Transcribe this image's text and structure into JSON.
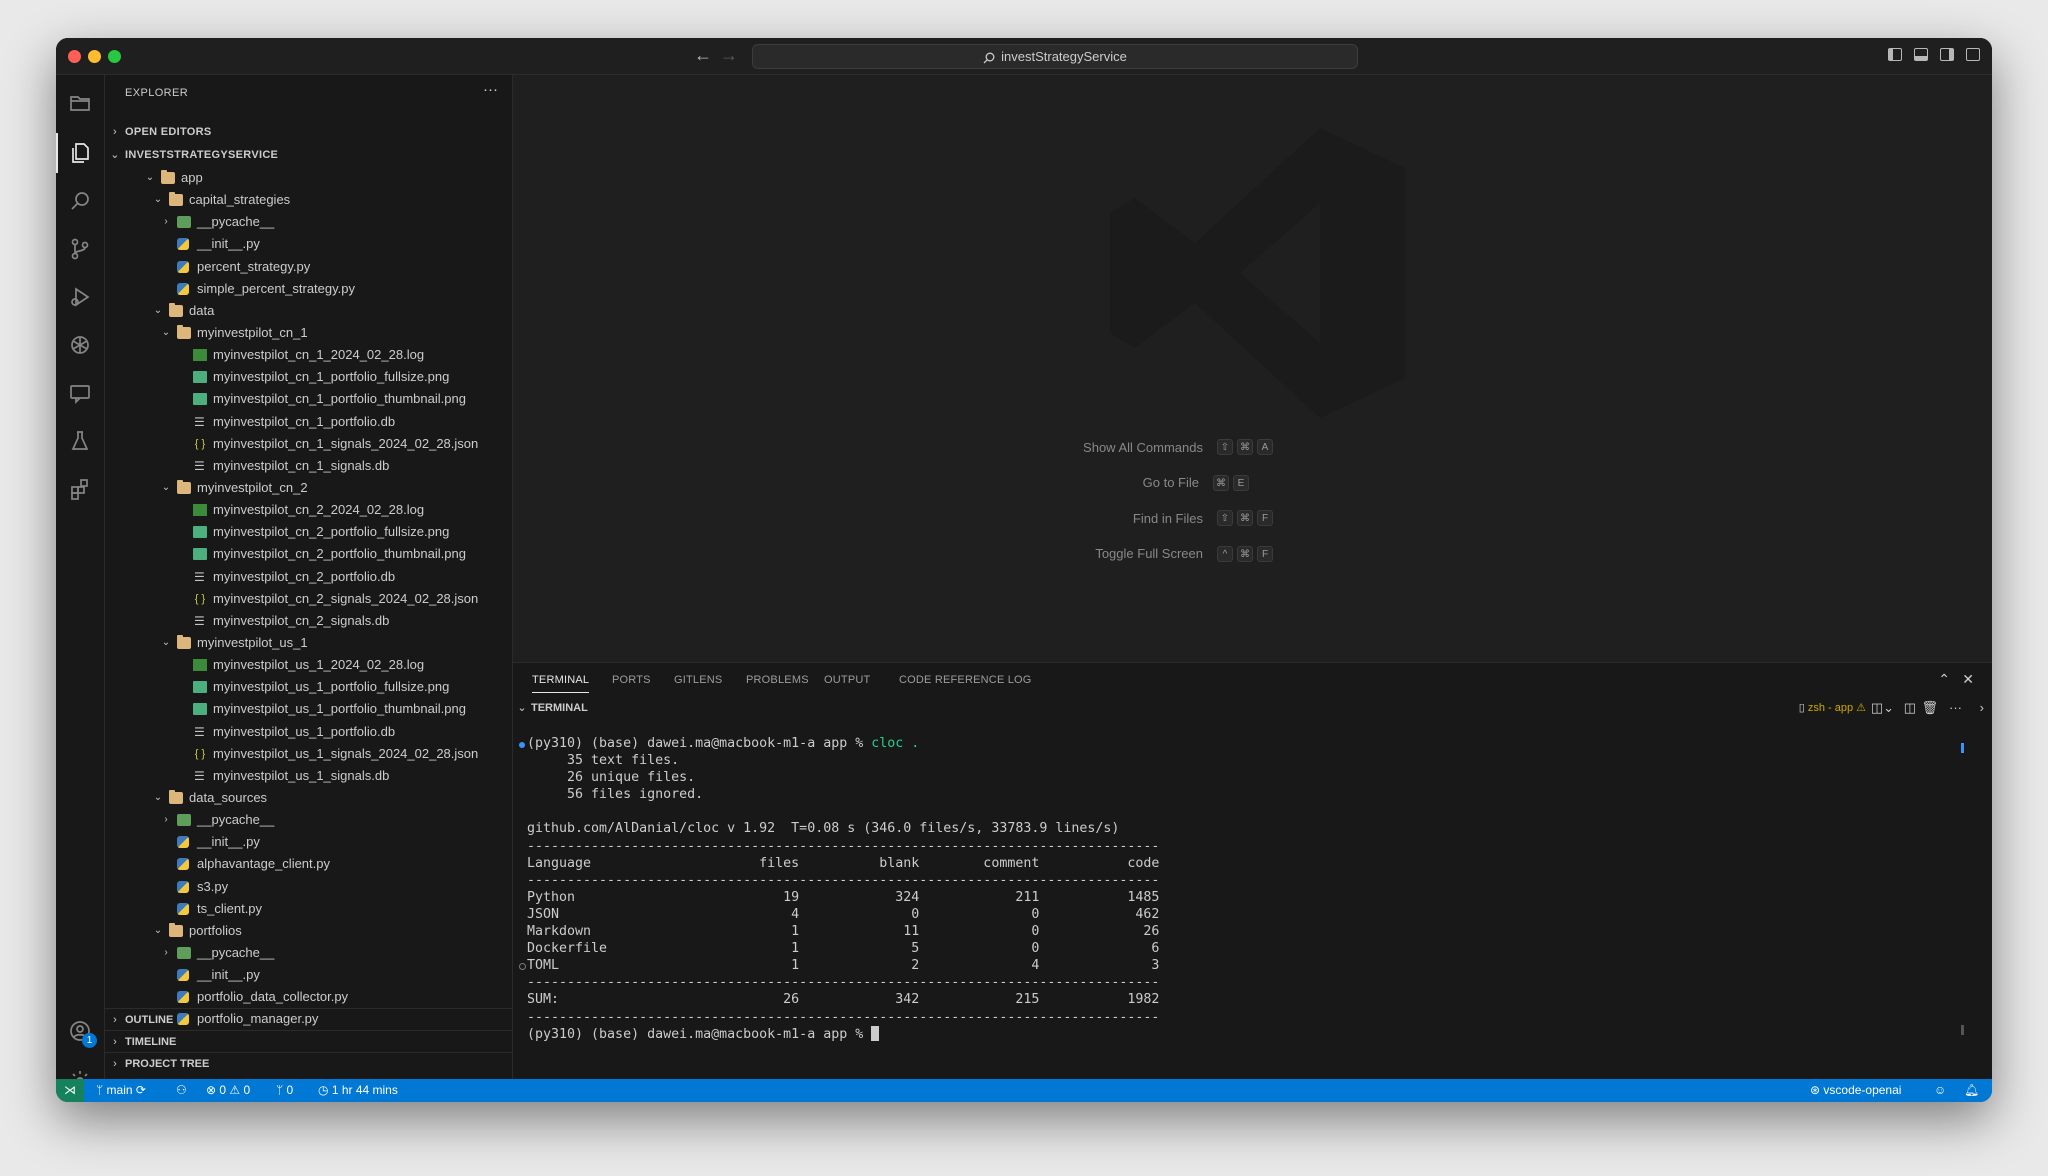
{
  "window": {
    "search": "investStrategyService"
  },
  "sidebar": {
    "title": "EXPLORER",
    "open_editors": "OPEN EDITORS",
    "project": "INVESTSTRATEGYSERVICE",
    "tree": [
      {
        "name": "app",
        "depth": 0,
        "type": "folder-open",
        "twisty": "open"
      },
      {
        "name": "capital_strategies",
        "depth": 1,
        "type": "folder-open",
        "twisty": "open"
      },
      {
        "name": "__pycache__",
        "depth": 2,
        "type": "folder-g",
        "twisty": "closed"
      },
      {
        "name": "__init__.py",
        "depth": 2,
        "type": "py"
      },
      {
        "name": "percent_strategy.py",
        "depth": 2,
        "type": "py"
      },
      {
        "name": "simple_percent_strategy.py",
        "depth": 2,
        "type": "py"
      },
      {
        "name": "data",
        "depth": 1,
        "type": "folder-open",
        "twisty": "open"
      },
      {
        "name": "myinvestpilot_cn_1",
        "depth": 2,
        "type": "folder-open",
        "twisty": "open"
      },
      {
        "name": "myinvestpilot_cn_1_2024_02_28.log",
        "depth": 3,
        "type": "log"
      },
      {
        "name": "myinvestpilot_cn_1_portfolio_fullsize.png",
        "depth": 3,
        "type": "png"
      },
      {
        "name": "myinvestpilot_cn_1_portfolio_thumbnail.png",
        "depth": 3,
        "type": "png"
      },
      {
        "name": "myinvestpilot_cn_1_portfolio.db",
        "depth": 3,
        "type": "db"
      },
      {
        "name": "myinvestpilot_cn_1_signals_2024_02_28.json",
        "depth": 3,
        "type": "json"
      },
      {
        "name": "myinvestpilot_cn_1_signals.db",
        "depth": 3,
        "type": "db"
      },
      {
        "name": "myinvestpilot_cn_2",
        "depth": 2,
        "type": "folder-open",
        "twisty": "open"
      },
      {
        "name": "myinvestpilot_cn_2_2024_02_28.log",
        "depth": 3,
        "type": "log"
      },
      {
        "name": "myinvestpilot_cn_2_portfolio_fullsize.png",
        "depth": 3,
        "type": "png"
      },
      {
        "name": "myinvestpilot_cn_2_portfolio_thumbnail.png",
        "depth": 3,
        "type": "png"
      },
      {
        "name": "myinvestpilot_cn_2_portfolio.db",
        "depth": 3,
        "type": "db"
      },
      {
        "name": "myinvestpilot_cn_2_signals_2024_02_28.json",
        "depth": 3,
        "type": "json"
      },
      {
        "name": "myinvestpilot_cn_2_signals.db",
        "depth": 3,
        "type": "db"
      },
      {
        "name": "myinvestpilot_us_1",
        "depth": 2,
        "type": "folder-open",
        "twisty": "open"
      },
      {
        "name": "myinvestpilot_us_1_2024_02_28.log",
        "depth": 3,
        "type": "log"
      },
      {
        "name": "myinvestpilot_us_1_portfolio_fullsize.png",
        "depth": 3,
        "type": "png"
      },
      {
        "name": "myinvestpilot_us_1_portfolio_thumbnail.png",
        "depth": 3,
        "type": "png"
      },
      {
        "name": "myinvestpilot_us_1_portfolio.db",
        "depth": 3,
        "type": "db"
      },
      {
        "name": "myinvestpilot_us_1_signals_2024_02_28.json",
        "depth": 3,
        "type": "json"
      },
      {
        "name": "myinvestpilot_us_1_signals.db",
        "depth": 3,
        "type": "db"
      },
      {
        "name": "data_sources",
        "depth": 1,
        "type": "folder-open",
        "twisty": "open"
      },
      {
        "name": "__pycache__",
        "depth": 2,
        "type": "folder-g",
        "twisty": "closed"
      },
      {
        "name": "__init__.py",
        "depth": 2,
        "type": "py"
      },
      {
        "name": "alphavantage_client.py",
        "depth": 2,
        "type": "py"
      },
      {
        "name": "s3.py",
        "depth": 2,
        "type": "py"
      },
      {
        "name": "ts_client.py",
        "depth": 2,
        "type": "py"
      },
      {
        "name": "portfolios",
        "depth": 1,
        "type": "folder-open",
        "twisty": "open"
      },
      {
        "name": "__pycache__",
        "depth": 2,
        "type": "folder-g",
        "twisty": "closed"
      },
      {
        "name": "__init__.py",
        "depth": 2,
        "type": "py"
      },
      {
        "name": "portfolio_data_collector.py",
        "depth": 2,
        "type": "py"
      },
      {
        "name": "portfolio_manager.py",
        "depth": 2,
        "type": "py"
      }
    ],
    "outline": "OUTLINE",
    "timeline": "TIMELINE",
    "project_tree": "PROJECT TREE"
  },
  "editor": {
    "shortcuts": [
      {
        "label": "Show All Commands",
        "keys": [
          "⇧",
          "⌘",
          "A"
        ]
      },
      {
        "label": "Go to File",
        "keys": [
          "⌘",
          "E"
        ]
      },
      {
        "label": "Find in Files",
        "keys": [
          "⇧",
          "⌘",
          "F"
        ]
      },
      {
        "label": "Toggle Full Screen",
        "keys": [
          "^",
          "⌘",
          "F"
        ]
      }
    ]
  },
  "panel": {
    "tabs": [
      "TERMINAL",
      "PORTS",
      "GITLENS",
      "PROBLEMS",
      "OUTPUT",
      "CODE REFERENCE LOG"
    ],
    "active_tab": "TERMINAL",
    "terminal_header": "TERMINAL",
    "shell_label": "zsh - app",
    "prompt": "(py310) (base) dawei.ma@macbook-m1-a app % ",
    "command": "cloc .",
    "output_lines": [
      "     35 text files.",
      "     26 unique files.",
      "     56 files ignored.",
      "",
      "github.com/AlDanial/cloc v 1.92  T=0.08 s (346.0 files/s, 33783.9 lines/s)",
      "-------------------------------------------------------------------------------",
      "Language                     files          blank        comment           code",
      "-------------------------------------------------------------------------------",
      "Python                          19            324            211           1485",
      "JSON                             4              0              0            462",
      "Markdown                         1             11              0             26",
      "Dockerfile                       1              5              0              6",
      "TOML                             1              2              4              3",
      "-------------------------------------------------------------------------------",
      "SUM:                            26            342            215           1982",
      "-------------------------------------------------------------------------------"
    ]
  },
  "statusbar": {
    "branch": "main",
    "errors": "0",
    "warnings": "0",
    "ports": "0",
    "time": "1 hr 44 mins",
    "account": "vscode-openai"
  },
  "colors": {
    "statusbar": "#0078d4",
    "accent_green": "#23d18b",
    "warning": "#cca700"
  }
}
